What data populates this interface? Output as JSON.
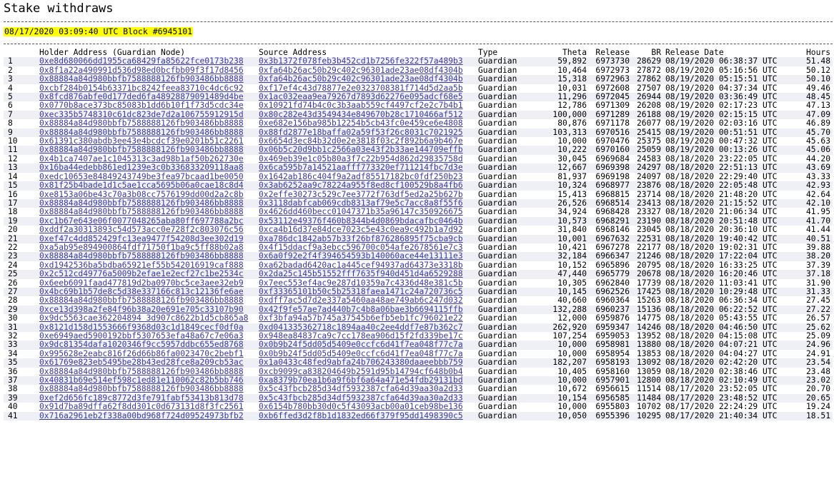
{
  "page": {
    "title": "Stake withdraws",
    "block_info": "08/17/2020 03:09:40 UTC Block #6945101"
  },
  "table": {
    "headers": [
      "",
      "Holder Address (Guardian Node)",
      "Source Address",
      "Type",
      "Theta",
      "Release",
      "BR",
      "Release Date",
      "Hours"
    ],
    "rows": [
      [
        "1",
        "0xe8d680066dd1955ca68429fa85622fce0173b238",
        "0x3b1372f078feb3b452cd1b7256fe322f57a489b3",
        "Guardian",
        "59,892",
        "6973730",
        "28629",
        "08/19/2020 06:38:37 UTC",
        "51.48"
      ],
      [
        "2",
        "0x8f1a22a490991d536d98ed0bcfbb09f3f17d8456",
        "0xfa64b26ac50b29c402c96301ade23ae08df4304b",
        "Guardian",
        "10,464",
        "6972973",
        "27872",
        "08/19/2020 05:16:56 UTC",
        "50.12"
      ],
      [
        "3",
        "0x88884a84d980bbfb7588888126fb903486bb8888",
        "0xfa64b26ac50b29c402c96301ade23ae08df4304b",
        "Guardian",
        "15,318",
        "6972963",
        "27862",
        "08/19/2020 05:15:51 UTC",
        "50.10"
      ],
      [
        "4",
        "0xcbf284b0154b63371bc8242feea83710c4dc6c92",
        "0xf17ef4c43d78877e2e0323708381f714d5d2aa5b",
        "Guardian",
        "10,031",
        "6972608",
        "27507",
        "08/19/2020 04:37:34 UTC",
        "49.46"
      ],
      [
        "5",
        "0x8fcd876abfe0d177ded6fa48928879091489d4be",
        "0x1ac032eaa9ea79267d7893d62276e095adcf68e5",
        "Guardian",
        "11,296",
        "6972045",
        "26944",
        "08/19/2020 03:36:49 UTC",
        "48.45"
      ],
      [
        "6",
        "0x0770b8ace373bc85083b1dd6b10f1f73d5cdc34e",
        "0x10921fd74b4c0c3b3aab559cf4497cf2e2c7b4b1",
        "Guardian",
        "12,786",
        "6971309",
        "26208",
        "08/19/2020 02:17:23 UTC",
        "47.13"
      ],
      [
        "7",
        "0xec335b5748310c61dc823de7d2a106755912915d",
        "0x80c282e43d3549434e849670b28c1710466af512",
        "Guardian",
        "100,000",
        "6971289",
        "26188",
        "08/19/2020 02:15:15 UTC",
        "47.09"
      ],
      [
        "8",
        "0x88884a84d980bbfb7588888126fb903486bb8888",
        "0xe682e156ba985b12254b5cb43fc0e459ce6e4808",
        "Guardian",
        "80,876",
        "6971178",
        "26077",
        "08/19/2020 02:03:16 UTC",
        "46.89"
      ],
      [
        "9",
        "0x88884a84d980bbfb7588888126fb903486bb8888",
        "0x88fd2877e18baffa02a59f53f26c8031c7021925",
        "Guardian",
        "103,313",
        "6970516",
        "25415",
        "08/19/2020 00:51:51 UTC",
        "45.70"
      ],
      [
        "10",
        "0x61391c380abdb3ee43e4bcdcf39e0201b51c2261",
        "0x6654d3ec84b32d0e2e3818f03c2f892b6a9b467e",
        "Guardian",
        "10,000",
        "6970476",
        "25375",
        "08/19/2020 00:47:32 UTC",
        "45.63"
      ],
      [
        "11",
        "0x88884a84d980bbfb7588888126fb903486bb8888",
        "0x06b5c20d9bb1c2566a03e43f2b33ae144709effb",
        "Guardian",
        "10,222",
        "6970160",
        "25059",
        "08/19/2020 00:13:26 UTC",
        "45.06"
      ],
      [
        "12",
        "0x4b1ca7407ae1c1045313c3ad98b1af50b262730e",
        "0x469eb39e1c05b80a3f7c22b954d862d29835758d",
        "Guardian",
        "30,045",
        "6969684",
        "24583",
        "08/18/2020 23:22:05 UTC",
        "44.20"
      ],
      [
        "13",
        "0x16ba44edebb861ed1239e3c0b336833209118aa8",
        "0x6ca595b7a14521aafff773320ef711214fbc7d3e",
        "Guardian",
        "12,667",
        "6969398",
        "24297",
        "08/18/2020 22:51:13 UTC",
        "43.69"
      ],
      [
        "14",
        "0xedc10653e84849243749be3fea97bcaad1be0050",
        "0x1642ab186c404f9a2adf85517182bc0fdf250b23",
        "Guardian",
        "81,937",
        "6969198",
        "24097",
        "08/18/2020 22:29:40 UTC",
        "43.33"
      ],
      [
        "15",
        "0x81f25b4bade1d1c5ae1cca5695b06a0cae18c8d4",
        "0x3ab6252aa9c78224a955f8ed8cf100529b8a4fb6",
        "Guardian",
        "10,324",
        "6968977",
        "23876",
        "08/18/2020 22:05:48 UTC",
        "42.93"
      ],
      [
        "16",
        "0xe8153a06be43c70a3b08cc7576199dd00d2a2c8b",
        "0x2effe30273c529c7ee3772f763df5ed2a25b627b",
        "Guardian",
        "15,413",
        "6968815",
        "23714",
        "08/18/2020 21:48:20 UTC",
        "42.64"
      ],
      [
        "17",
        "0x88884a84d980bbfb7588888126fb903486bb8888",
        "0x3118dabfcab069cdb8313af79e5c7acc8a8f55f6",
        "Guardian",
        "26,526",
        "6968514",
        "23413",
        "08/18/2020 21:15:52 UTC",
        "42.10"
      ],
      [
        "18",
        "0x88884a84d980bbfb7588888126fb903486bb8888",
        "0x4626dd460becc01047371b35a96147c350926675",
        "Guardian",
        "34,924",
        "6968428",
        "23327",
        "08/18/2020 21:06:34 UTC",
        "41.95"
      ],
      [
        "19",
        "0xc1b67e643e06f0077048265aba80ff697788a2bc",
        "0x53112e49376f460b8344b4d0869bdacafbc0464b",
        "Guardian",
        "10,573",
        "6968291",
        "23190",
        "08/18/2020 20:51:48 UTC",
        "41.70"
      ],
      [
        "20",
        "0xddf2a30313893c54d573acc0e728f2c803076c56",
        "0xca4b16d37e84dce7023c5e43c0ea9c492b1a7d92",
        "Guardian",
        "31,840",
        "6968146",
        "23045",
        "08/18/2020 20:36:10 UTC",
        "41.44"
      ],
      [
        "21",
        "0xef47c4dd852429fc13ea9477f54208d3ee302d19",
        "0xa786dc1842ab57b33f26bf876286895f75cba9cb",
        "Guardian",
        "10,001",
        "6967632",
        "22531",
        "08/18/2020 19:40:42 UTC",
        "40.51"
      ],
      [
        "22",
        "0xa5ab95e894900864fdf71750f1ba9c5ff88b02a8",
        "0x4f15ddacf9a3ebcc596700c054afe2678561e7c3",
        "Guardian",
        "10,421",
        "6967278",
        "22177",
        "08/18/2020 19:02:31 UTC",
        "39.88"
      ],
      [
        "23",
        "0x88884a84d980bbfb7588888126fb903486bb8888",
        "0x6a0f92e2f4f394654593b140060ace44e13111e3",
        "Guardian",
        "32,184",
        "6966347",
        "21246",
        "08/18/2020 17:22:04 UTC",
        "38.20"
      ],
      [
        "24",
        "0xd1942536ba5bdba65921ef55b542016919caf888",
        "0xa62badad6420ac1a445cef94937ad64373e3318b",
        "Guardian",
        "10,152",
        "6965896",
        "20795",
        "08/18/2020 16:33:25 UTC",
        "37.39"
      ],
      [
        "25",
        "0x2c512cd49776a5009b2efae1e2ecf27c1be2534c",
        "0x2da25c145b51552fff7635f940d451d4a6529288",
        "Guardian",
        "47,440",
        "6965779",
        "20678",
        "08/18/2020 16:20:46 UTC",
        "37.18"
      ],
      [
        "26",
        "0x6eeb6091faad477819d2ba0970bc5ce3aee32eb9",
        "0x7eec553ef4ac9e287d10359a7c4336d48e381c5b",
        "Guardian",
        "10,305",
        "6962840",
        "17739",
        "08/18/2020 11:03:41 UTC",
        "31.90"
      ],
      [
        "27",
        "0x4bc69b1b57de8c5d38e337166c813c12136fe6ae",
        "0xf33365101b50c5b25318faea1471c24a720736c5",
        "Guardian",
        "10,145",
        "6962526",
        "17425",
        "08/18/2020 10:29:48 UTC",
        "31.33"
      ],
      [
        "28",
        "0x88884a84d980bbfb7588888126fb903486bb8888",
        "0xdff7ac5d7d2e337a5460aa48ae749ab6c247d032",
        "Guardian",
        "40,660",
        "6960364",
        "15263",
        "08/18/2020 06:36:34 UTC",
        "27.45"
      ],
      [
        "29",
        "0xce13d398a2fe84f96b38a20e691e705c33107b90",
        "0x42f9fe57ae7ad440b7c4b8a06bae3b6694115ffb",
        "Guardian",
        "132,288",
        "6960237",
        "15136",
        "08/18/2020 06:22:52 UTC",
        "27.22"
      ],
      [
        "30",
        "0x9dc5563cae362204894 3d907c8622b1d5cb865a8",
        "0xf3bfa94a57b745a37545b6efb5eb1fc796021e22",
        "Guardian",
        "12,000",
        "6959876",
        "14775",
        "08/18/2020 05:43:55 UTC",
        "26.57"
      ],
      [
        "31",
        "0x8121d158d1553666f9368d03c1d1849cecf0df0a",
        "0xd041335362718c1894aa40c2ee4ddf7e87b362c7",
        "Guardian",
        "262,920",
        "6959347",
        "14246",
        "08/18/2020 04:46:50 UTC",
        "25.62"
      ],
      [
        "32",
        "0xe6949aed5900192bbf5307653efa48a67c7e06a3",
        "0x948ea84837ca9c7cc178ea906d15f2fd339be17c",
        "Guardian",
        "107,254",
        "6959053",
        "13952",
        "08/18/2020 04:15:08 UTC",
        "25.09"
      ],
      [
        "33",
        "0x9dc81354dafa1020346f9cc5957ddbc655ed8768",
        "0x0b9b24f5dd05d5409e0ccfc6d41f7ea048f77c7a",
        "Guardian",
        "10,000",
        "6958981",
        "13880",
        "08/18/2020 04:07:21 UTC",
        "24.96"
      ],
      [
        "34",
        "0x995628e2eabc816f26d66b86fa0023470c2bebf1",
        "0x0b9b24f5dd05d5409e0ccfc6d41f7ea048f77c7a",
        "Guardian",
        "10,000",
        "6958954",
        "13853",
        "08/18/2020 04:04:27 UTC",
        "24.91"
      ],
      [
        "35",
        "0x61769e823eb5495be28b43ed28fce8a209cb53ac",
        "0x1a0433c48fed9abfa24b706243380daaeebbb759",
        "Guardian",
        "182,207",
        "6958193",
        "13092",
        "08/18/2020 02:42:20 UTC",
        "23.54"
      ],
      [
        "36",
        "0x88884a84d980bbfb7588888126fb903486bb8888",
        "0xcb9099ca838204649b2591d95b14794cf648b0b4",
        "Guardian",
        "10,405",
        "6958160",
        "13059",
        "08/18/2020 02:38:46 UTC",
        "23.48"
      ],
      [
        "37",
        "0x40831b69e514ef598c1ed81e110062c82b5bb746",
        "0xa8379b70ea1b6a9f6bf6a64a471e54fdb29131bd",
        "Guardian",
        "10,000",
        "6957901",
        "12800",
        "08/18/2020 02:10:49 UTC",
        "23.02"
      ],
      [
        "38",
        "0x88884a84d980bbfb7588888126fb903486bb8888",
        "0x5c43fbcb285d34df5932387cfa64d39aa30a2d33",
        "Guardian",
        "10,672",
        "6956615",
        "11514",
        "08/17/2020 23:52:05 UTC",
        "20.70"
      ],
      [
        "39",
        "0xef2d656fc189c8772d3fe791fabf53413b813d78",
        "0x5c43fbcb285d34df5932387cfa64d39aa30a2d33",
        "Guardian",
        "10,154",
        "6956585",
        "11484",
        "08/17/2020 23:48:52 UTC",
        "20.65"
      ],
      [
        "40",
        "0x91d7ba89dffa62f8dd301c0d673131d8f3fc2561",
        "0x6154b780bb30d0c5f43093acb00a01ceb98be136",
        "Guardian",
        "10,000",
        "6955803",
        "10702",
        "08/17/2020 22:24:29 UTC",
        "19.24"
      ],
      [
        "41",
        "0x716a2961eb2f338a00bd968f724d09524973bfb2",
        "0xb6ffed3d2f8b1d1832ed66f379f95dd1498390c5",
        "Guardian",
        "10,050",
        "6955396",
        "10295",
        "08/17/2020 21:40:34 UTC",
        "18.51"
      ]
    ]
  }
}
